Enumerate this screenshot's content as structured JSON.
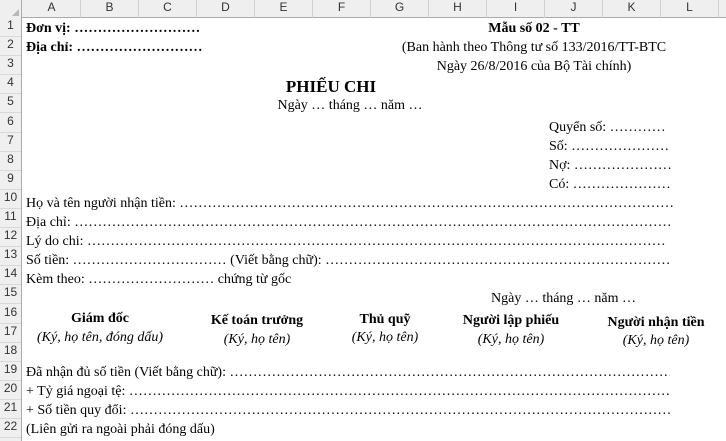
{
  "columns": [
    "A",
    "B",
    "C",
    "D",
    "E",
    "F",
    "G",
    "H",
    "I",
    "J",
    "K",
    "L"
  ],
  "rows": [
    "1",
    "2",
    "3",
    "4",
    "5",
    "6",
    "7",
    "8",
    "9",
    "10",
    "11",
    "12",
    "13",
    "14",
    "15",
    "16",
    "17",
    "18",
    "19",
    "20",
    "21",
    "22"
  ],
  "header": {
    "unit": "Đơn vị: ………………………",
    "address": "Địa chỉ: ………………………",
    "form_no": "Mẫu số 02 - TT",
    "issued_by": "(Ban hành theo Thông tư số 133/2016/TT-BTC",
    "issued_date": "Ngày 26/8/2016 của Bộ Tài chính)"
  },
  "title": "PHIẾU CHI",
  "date_line": "Ngày … tháng … năm …",
  "book": {
    "book_no": "Quyển số: …………",
    "number": "Số: …………………",
    "debit": "Nợ: …………………",
    "credit": "Có: …………………"
  },
  "fields": {
    "recipient": "Họ và tên người nhận tiền: …………………………………………………………………………………………………………………………………………",
    "address": "Địa chỉ: ……………………………………………………………………………………………………………………………………………………………",
    "reason": "Lý do chi: ………………………………………………………………………………………………………………………………………………………",
    "amount": "Số tiền: …………………………… (Viết bằng chữ): ……………………………………………………………………………………………",
    "attached": "Kèm theo: ……………………… chứng từ gốc"
  },
  "sign_date": "Ngày … tháng … năm …",
  "signatures": [
    {
      "role": "Giám đốc",
      "note": "(Ký, họ tên, đóng dấu)"
    },
    {
      "role": "Kế toán trưởng",
      "note": "(Ký, họ tên)"
    },
    {
      "role": "Thủ quỹ",
      "note": "(Ký, họ tên)"
    },
    {
      "role": "Người lập phiếu",
      "note": "(Ký, họ tên)"
    },
    {
      "role": "Người nhận tiền",
      "note": "(Ký, họ tên)"
    }
  ],
  "footer": {
    "received": "Đã nhận đủ số tiền (Viết bằng chữ): ………………………………………………………………………………………………………………",
    "rate": "+ Tỷ giá ngoại tệ: ……………………………………………………………………………………………………………………………………",
    "converted": "+ Số tiền quy đổi: ……………………………………………………………………………………………………………………………………",
    "note": "(Liên gửi ra ngoài phải đóng dấu)"
  }
}
